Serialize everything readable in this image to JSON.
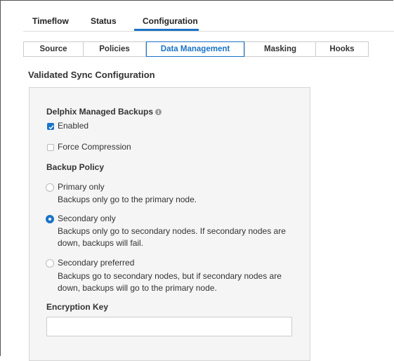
{
  "top_tabs": [
    {
      "label": "Timeflow"
    },
    {
      "label": "Status"
    },
    {
      "label": "Configuration",
      "active": true
    }
  ],
  "sub_tabs": [
    {
      "label": "Source"
    },
    {
      "label": "Policies"
    },
    {
      "label": "Data Management",
      "active": true
    },
    {
      "label": "Masking"
    },
    {
      "label": "Hooks"
    }
  ],
  "section_title": "Validated Sync Configuration",
  "managed_backups": {
    "label": "Delphix Managed Backups",
    "info_icon": "info-icon",
    "enabled": {
      "label": "Enabled",
      "checked": true
    },
    "force_compression": {
      "label": "Force Compression",
      "checked": false
    }
  },
  "backup_policy": {
    "label": "Backup Policy",
    "options": [
      {
        "label": "Primary only",
        "description": "Backups only go to the primary node.",
        "selected": false
      },
      {
        "label": "Secondary only",
        "description_line1": "Backups only go to secondary nodes. If secondary nodes are",
        "description_line2": "down, backups will fail.",
        "selected": true
      },
      {
        "label": "Secondary preferred",
        "description_line1": "Backups go to secondary nodes, but if secondary nodes are",
        "description_line2": "down, backups will go to the primary node.",
        "selected": false
      }
    ]
  },
  "encryption_key": {
    "label": "Encryption Key",
    "value": ""
  },
  "colors": {
    "accent": "#1a73c8",
    "panel_background": "#f5f5f5"
  }
}
